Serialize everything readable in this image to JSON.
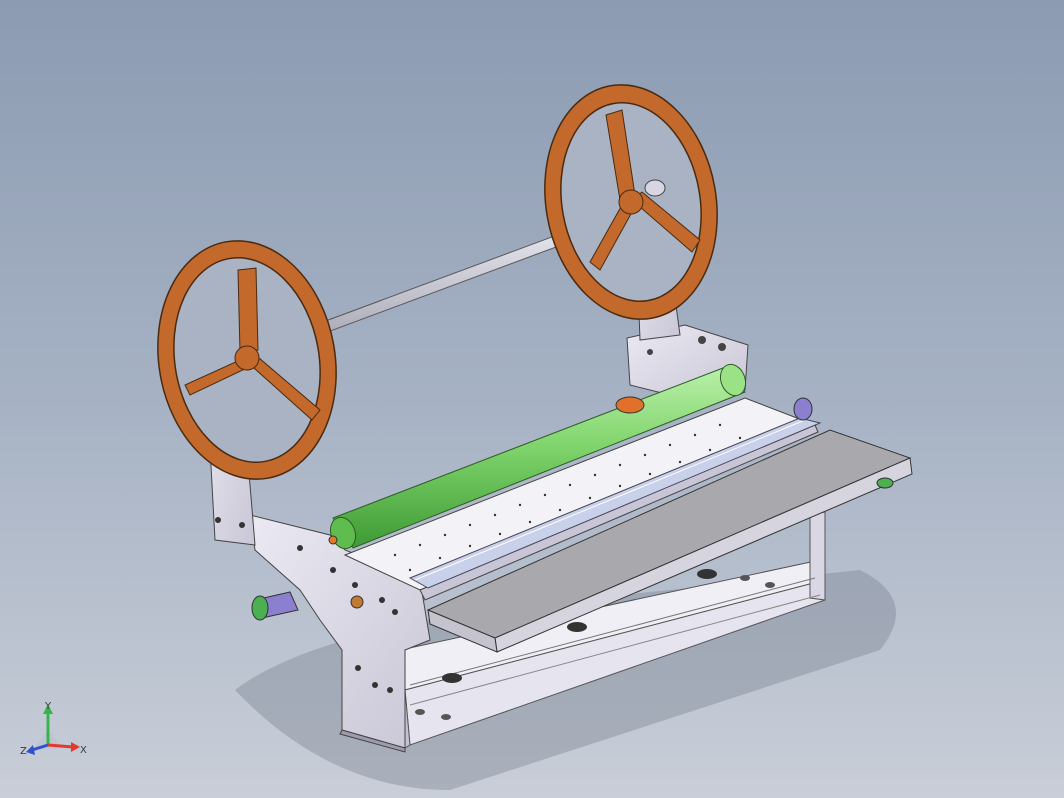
{
  "view": {
    "background_top": "#8c9bb2",
    "background_bottom": "#c9ced8"
  },
  "triad": {
    "x_label": "X",
    "y_label": "Y",
    "z_label": "Z",
    "x_color": "#e23b2e",
    "y_color": "#38b54a",
    "z_color": "#2f52c9"
  },
  "model": {
    "reel_color": "#c2692b",
    "roller_color": "#7ed36a",
    "frame_color": "#d8d6e2",
    "tray_color": "#a9a8ad",
    "shaft_color": "#d8d9e4",
    "knob_color": "#8b7fd0"
  }
}
